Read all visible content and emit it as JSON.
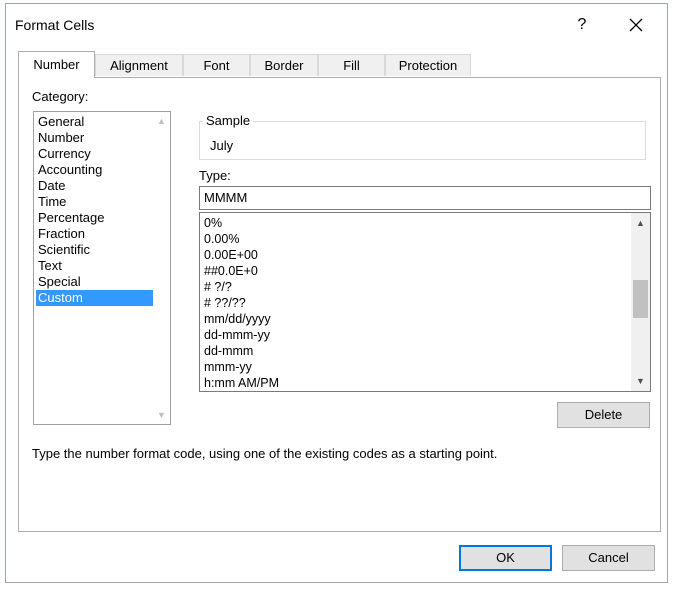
{
  "dialog": {
    "title": "Format Cells",
    "help_label": "?",
    "tabs": [
      "Number",
      "Alignment",
      "Font",
      "Border",
      "Fill",
      "Protection"
    ],
    "active_tab": "Number"
  },
  "category": {
    "label": "Category:",
    "items": [
      "General",
      "Number",
      "Currency",
      "Accounting",
      "Date",
      "Time",
      "Percentage",
      "Fraction",
      "Scientific",
      "Text",
      "Special",
      "Custom"
    ],
    "selected": "Custom"
  },
  "sample": {
    "label": "Sample",
    "value": "July"
  },
  "type": {
    "label": "Type:",
    "value": "MMMM"
  },
  "formats": [
    "0%",
    "0.00%",
    "0.00E+00",
    "##0.0E+0",
    "# ?/?",
    "# ??/??",
    "mm/dd/yyyy",
    "dd-mmm-yy",
    "dd-mmm",
    "mmm-yy",
    "h:mm AM/PM"
  ],
  "buttons": {
    "delete": "Delete",
    "ok": "OK",
    "cancel": "Cancel"
  },
  "hint": "Type the number format code, using one of the existing codes as a starting point.",
  "colors": {
    "selection": "#3399ff",
    "default_button_border": "#0078d7"
  },
  "icons": [
    "close-icon",
    "scroll-up-arrow-icon",
    "scroll-down-arrow-icon"
  ]
}
